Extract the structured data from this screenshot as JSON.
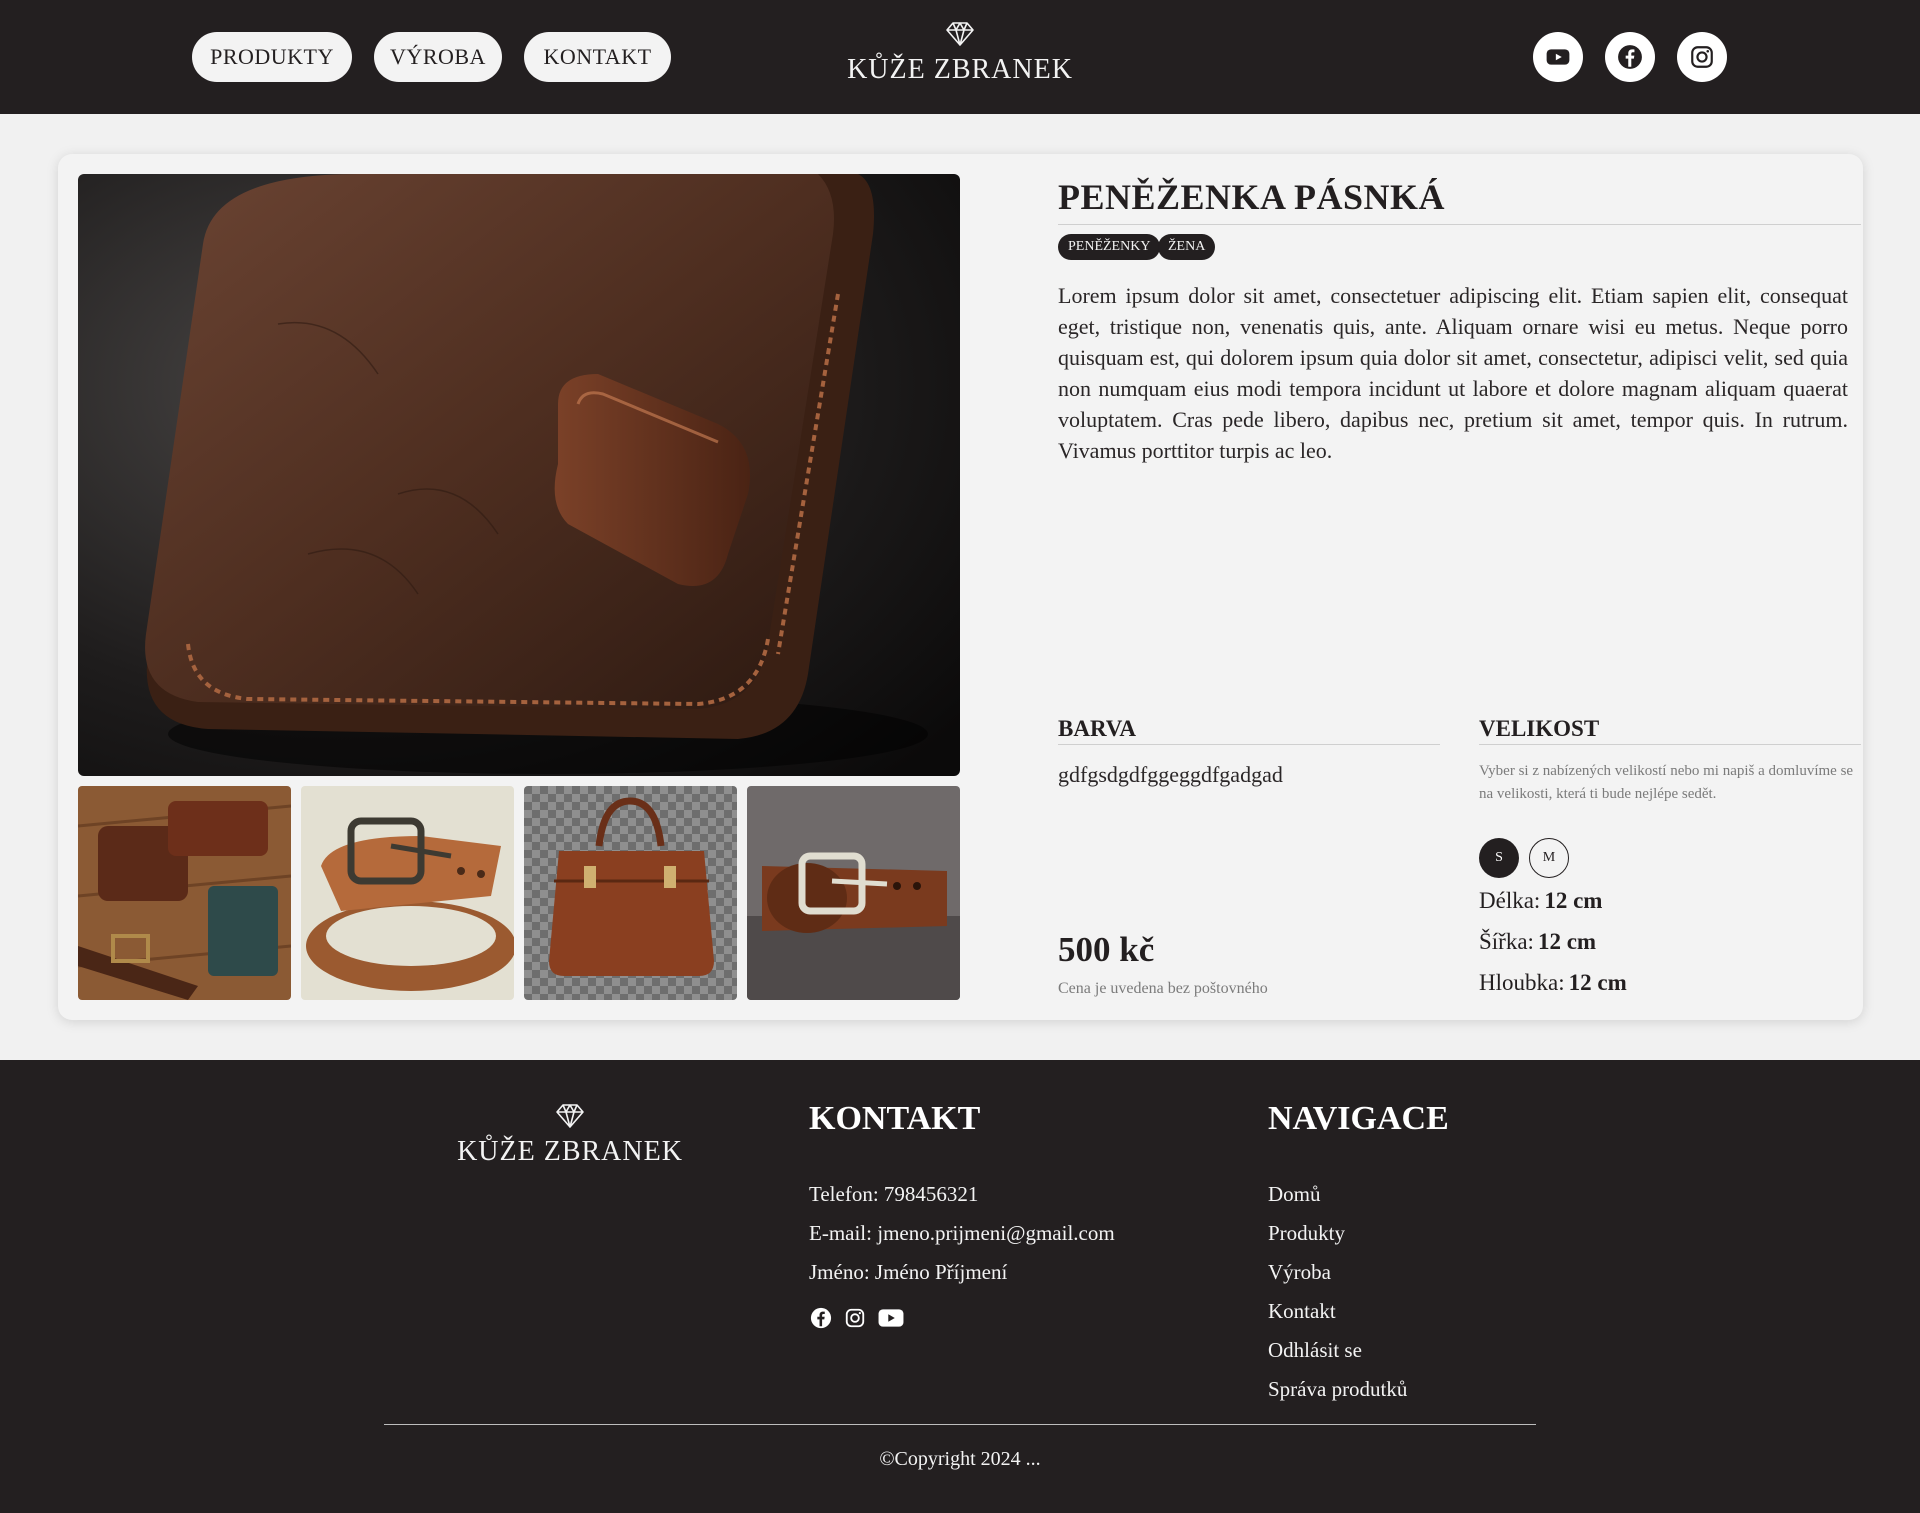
{
  "header": {
    "nav": [
      "PRODUKTY",
      "VÝROBA",
      "KONTAKT"
    ],
    "brand": "KŮŽE ZBRANEK",
    "social": [
      "youtube-icon",
      "facebook-icon",
      "instagram-icon"
    ]
  },
  "product": {
    "title": "PENĚŽENKA PÁSNKÁ",
    "tags": [
      "PENĚŽENKY",
      "ŽENA"
    ],
    "description": "Lorem ipsum dolor sit amet, consectetuer adipiscing elit. Etiam sapien elit, consequat eget, tristique non, venenatis quis, ante. Aliquam ornare wisi eu metus. Neque porro quisquam est, qui dolorem ipsum quia dolor sit amet, consectetur, adipisci velit, sed quia non numquam eius modi tempora incidunt ut labore et dolore magnam aliquam quaerat voluptatem. Cras pede libero, dapibus nec, pretium sit amet, tempor quis. In rutrum. Vivamus porttitor turpis ac leo.",
    "color_heading": "BARVA",
    "color_value": "gdfgsdgdfggeggdfgadgad",
    "size_heading": "VELIKOST",
    "size_hint": "Vyber si z nabízených velikostí nebo mi napiš a domluvíme se na velikosti, která ti bude nejlépe sedět.",
    "sizes": [
      "S",
      "M"
    ],
    "selected_size": "S",
    "dims": [
      {
        "label": "Délka:",
        "value": "12 cm"
      },
      {
        "label": "Šířka:",
        "value": "12 cm"
      },
      {
        "label": "Hloubka:",
        "value": "12 cm"
      }
    ],
    "price": "500 kč",
    "price_note": "Cena je uvedena bez poštovného"
  },
  "footer": {
    "brand": "KŮŽE ZBRANEK",
    "contact_heading": "KONTAKT",
    "contact": [
      {
        "label": "Telefon:",
        "value": "798456321"
      },
      {
        "label": "E-mail:",
        "value": "jmeno.prijmeni@gmail.com"
      },
      {
        "label": "Jméno:",
        "value": "Jméno Příjmení"
      }
    ],
    "nav_heading": "NAVIGACE",
    "nav": [
      "Domů",
      "Produkty",
      "Výroba",
      "Kontakt",
      "Odhlásit se",
      "Správa produtků"
    ],
    "copyright": "©Copyright 2024 ..."
  },
  "colors": {
    "dark": "#231f20",
    "light": "#f3f3f3",
    "muted": "#7b7b7b"
  }
}
